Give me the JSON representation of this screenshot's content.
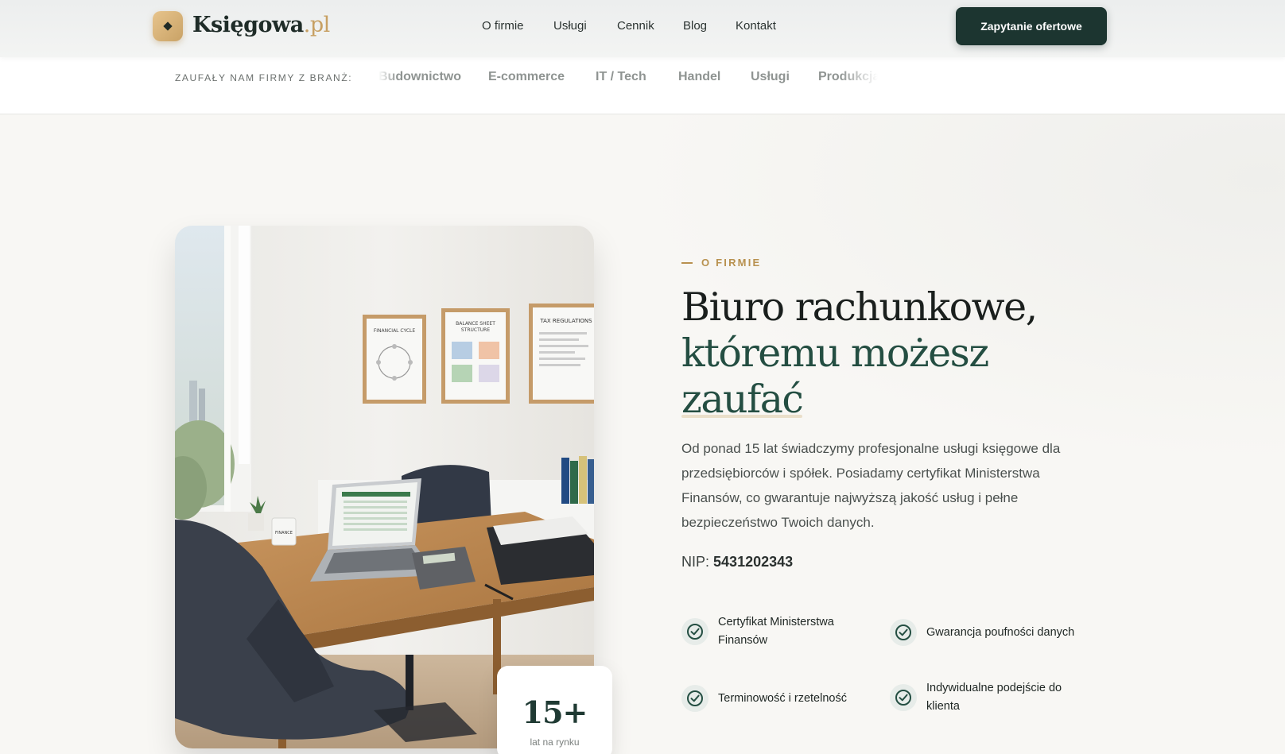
{
  "brand": {
    "name": "Księgowa",
    "tld": ".pl"
  },
  "nav": {
    "items": [
      "O firmie",
      "Usługi",
      "Cennik",
      "Blog",
      "Kontakt"
    ],
    "cta_label": "Zapytanie ofertowe"
  },
  "industries": {
    "label": "ZAUFAŁY NAM FIRMY Z BRANŻ:",
    "items": [
      "Budownictwo",
      "E-commerce",
      "IT / Tech",
      "Handel",
      "Usługi",
      "Produkcja"
    ]
  },
  "about": {
    "eyebrow": "O FIRMIE",
    "headline_line1": "Biuro rachunkowe,",
    "headline_line2": "któremu możesz",
    "headline_line3": "zaufać",
    "description": "Od ponad 15 lat świadczymy profesjonalne usługi księgowe dla przedsiębiorców i spółek. Posiadamy certyfikat Ministerstwa Finansów, co gwarantuje najwyższą jakość usług i pełne bezpieczeństwo Twoich danych.",
    "nip_label": "NIP:",
    "nip_value": "5431202343",
    "features": [
      "Certyfikat Ministerstwa Finansów",
      "Gwarancja poufności danych",
      "Terminowość i rzetelność",
      "Indywidualne podejście do klienta"
    ]
  },
  "badge": {
    "number": "15+",
    "label": "lat na rynku"
  },
  "photo": {
    "poster_titles": [
      "FINANCIAL CYCLE",
      "BALANCE SHEET STRUCTURE",
      "TAX REGULATIONS"
    ],
    "mug_text": "FINANCE"
  },
  "colors": {
    "primary": "#1c3530",
    "accent_gold": "#c7a063",
    "headline_green": "#244e42"
  },
  "icons": {
    "logo": "diamond-icon",
    "feature": "check-circle-icon"
  }
}
